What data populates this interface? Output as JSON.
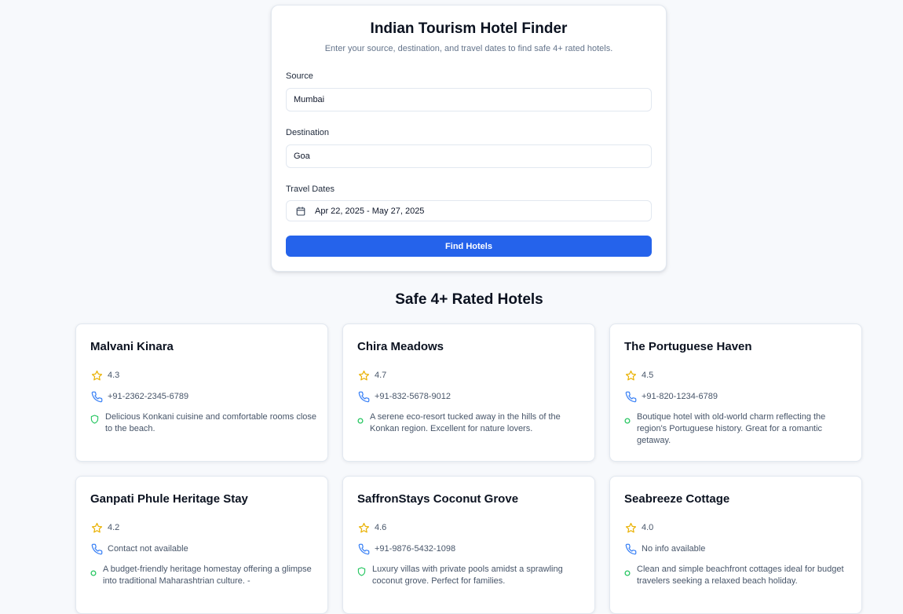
{
  "form": {
    "title": "Indian Tourism Hotel Finder",
    "subtitle": "Enter your source, destination, and travel dates to find safe 4+ rated hotels.",
    "source_label": "Source",
    "source_value": "Mumbai",
    "destination_label": "Destination",
    "destination_value": "Goa",
    "dates_label": "Travel Dates",
    "dates_value": "Apr 22, 2025 - May 27, 2025",
    "submit_label": "Find Hotels"
  },
  "results": {
    "title": "Safe 4+ Rated Hotels",
    "hotels": [
      {
        "name": "Malvani Kinara",
        "rating": "4.3",
        "contact": "+91-2362-2345-6789",
        "description": "Delicious Konkani cuisine and comfortable rooms close to the beach.",
        "safety_icon": "shield-icon"
      },
      {
        "name": "Chira Meadows",
        "rating": "4.7",
        "contact": "+91-832-5678-9012",
        "description": "A serene eco-resort tucked away in the hills of the Konkan region. Excellent for nature lovers.",
        "safety_icon": "circle-icon"
      },
      {
        "name": "The Portuguese Haven",
        "rating": "4.5",
        "contact": "+91-820-1234-6789",
        "description": "Boutique hotel with old-world charm reflecting the region's Portuguese history. Great for a romantic getaway.",
        "safety_icon": "circle-icon"
      },
      {
        "name": "Ganpati Phule Heritage Stay",
        "rating": "4.2",
        "contact": "Contact not available",
        "description": "A budget-friendly heritage homestay offering a glimpse into traditional Maharashtrian culture. -",
        "safety_icon": "circle-icon"
      },
      {
        "name": "SaffronStays Coconut Grove",
        "rating": "4.6",
        "contact": "+91-9876-5432-1098",
        "description": "Luxury villas with private pools amidst a sprawling coconut grove. Perfect for families.",
        "safety_icon": "shield-icon"
      },
      {
        "name": "Seabreeze Cottage",
        "rating": "4.0",
        "contact": "No info available",
        "description": "Clean and simple beachfront cottages ideal for budget travelers seeking a relaxed beach holiday.",
        "safety_icon": "circle-icon"
      }
    ]
  },
  "colors": {
    "primary": "#2563eb",
    "star": "#eab308",
    "phone": "#3b82f6",
    "safe": "#22c55e"
  }
}
